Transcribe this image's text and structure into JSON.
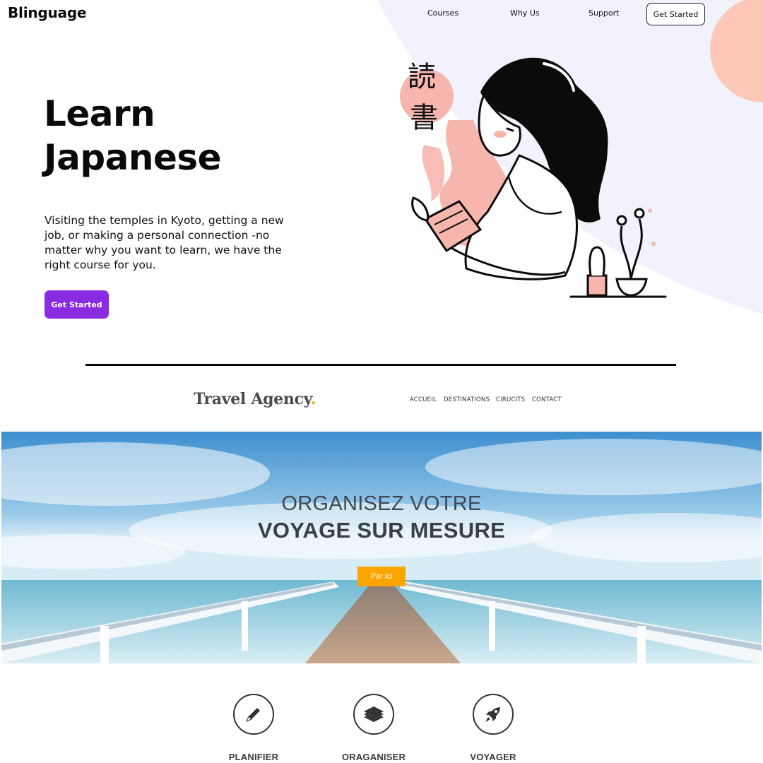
{
  "blinguage": {
    "brand": "Blinguage",
    "nav": {
      "links": [
        "Courses",
        "Why Us",
        "Support"
      ],
      "cta": "Get Started"
    },
    "hero": {
      "title_line1": "Learn",
      "title_line2": "Japanese",
      "description": "Visiting the temples in Kyoto, getting a new job, or making a personal connection -no matter why you want to learn, we have the right course for you.",
      "cta": "Get Started"
    },
    "illustration": {
      "kanji_top": "読",
      "kanji_bottom": "書"
    },
    "colors": {
      "accent": "#8a2be2",
      "lavender": "#f1f2fc",
      "peach": "#fdc8b8",
      "pink": "#f6b6ae"
    }
  },
  "travel": {
    "logo_text": "Travel Agency",
    "logo_dot": ".",
    "nav": [
      "ACCUEIL",
      "DESTINATIONS",
      "CIRUCITS",
      "CONTACT"
    ],
    "banner": {
      "line1": "ORGANISEZ VOTRE",
      "line2": "VOYAGE SUR MESURE",
      "cta": "Par ici"
    },
    "features": [
      {
        "label": "PLANIFIER",
        "icon": "pen-icon"
      },
      {
        "label": "ORAGANISER",
        "icon": "layers-icon"
      },
      {
        "label": "VOYAGER",
        "icon": "rocket-icon"
      }
    ],
    "colors": {
      "accent": "#fba600",
      "text": "#3a3f45"
    }
  }
}
